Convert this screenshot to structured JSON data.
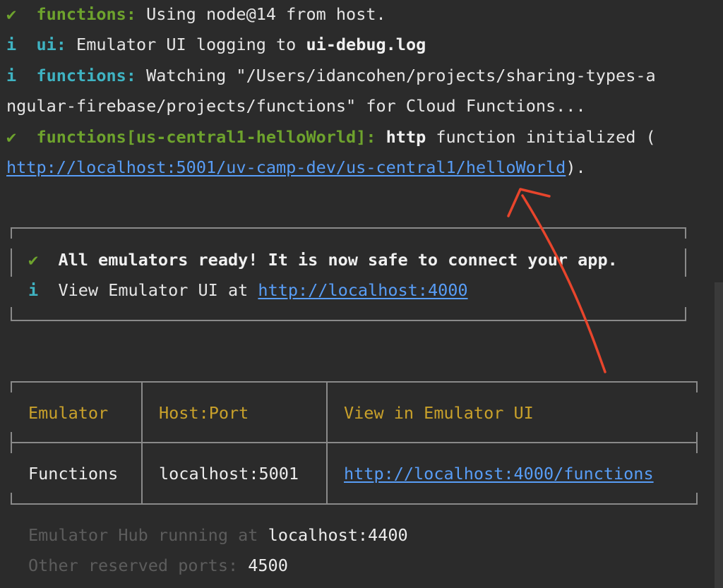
{
  "log": {
    "l1": {
      "mark": "✔",
      "tag": "functions:",
      "text": " Using node@14 from host."
    },
    "l2": {
      "mark": "i",
      "tag": "ui:",
      "text_a": " Emulator UI logging to ",
      "file": "ui-debug.log"
    },
    "l3": {
      "mark": "i",
      "tag": "functions:",
      "text": " Watching \"/Users/idancohen/projects/sharing-types-a"
    },
    "l4": {
      "text": "ngular-firebase/projects/functions\" for Cloud Functions..."
    },
    "l5": {
      "mark": "✔",
      "tag": "functions[us-central1-helloWorld]:",
      "http": "http",
      "text": " function initialized ("
    },
    "l6": {
      "url": "http://localhost:5001/uv-camp-dev/us-central1/helloWorld",
      "suffix": ")."
    }
  },
  "ready_box": {
    "line1": {
      "mark": "✔",
      "text": "All emulators ready! It is now safe to connect your app."
    },
    "line2": {
      "mark": "i",
      "text": "View Emulator UI at ",
      "url": "http://localhost:4000"
    }
  },
  "table": {
    "headers": [
      "Emulator",
      "Host:Port",
      "View in Emulator UI"
    ],
    "rows": [
      [
        "Functions",
        "localhost:5001",
        "http://localhost:4000/functions"
      ]
    ]
  },
  "footer": {
    "hub_label": "Emulator Hub running at ",
    "hub_value": "localhost:4400",
    "ports_label": "Other reserved ports: ",
    "ports_value": "4500"
  },
  "colors": {
    "background": "#2b2b2b",
    "success": "#6ea32d",
    "info": "#3fb3c2",
    "link": "#589df6",
    "header": "#c9a12b",
    "annotation_arrow": "#e8452c"
  }
}
